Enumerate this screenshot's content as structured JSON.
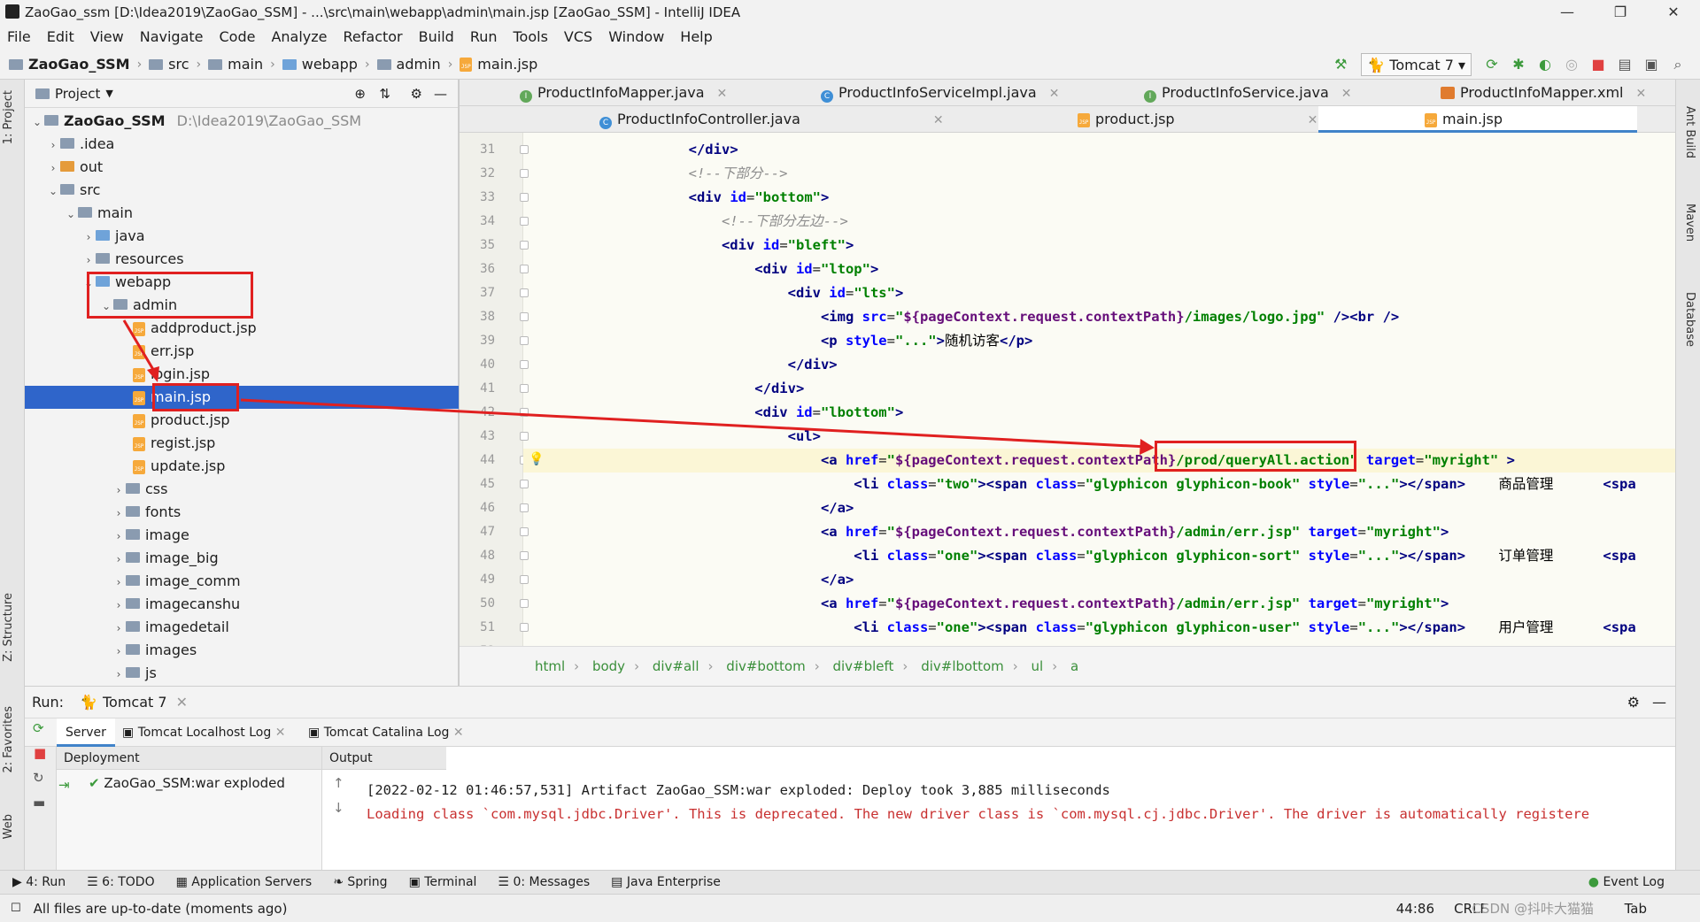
{
  "window": {
    "title": "ZaoGao_ssm [D:\\Idea2019\\ZaoGao_SSM] - ...\\src\\main\\webapp\\admin\\main.jsp [ZaoGao_SSM] - IntelliJ IDEA",
    "minimize": "—",
    "restore": "❐",
    "close": "✕"
  },
  "menu": [
    "File",
    "Edit",
    "View",
    "Navigate",
    "Code",
    "Analyze",
    "Refactor",
    "Build",
    "Run",
    "Tools",
    "VCS",
    "Window",
    "Help"
  ],
  "navbar": {
    "crumbs": [
      "ZaoGao_SSM",
      "src",
      "main",
      "webapp",
      "admin",
      "main.jsp"
    ],
    "run_config": "Tomcat 7"
  },
  "left_strip": {
    "project": "1: Project",
    "structure": "Z: Structure",
    "favorites": "2: Favorites",
    "web": "Web"
  },
  "right_strip": {
    "ant": "Ant Build",
    "maven": "Maven",
    "database": "Database"
  },
  "project": {
    "header": "Project",
    "root_name": "ZaoGao_SSM",
    "root_path": "D:\\Idea2019\\ZaoGao_SSM",
    "items": [
      ".idea",
      "out",
      "src",
      "main",
      "java",
      "resources",
      "webapp",
      "admin",
      "addproduct.jsp",
      "err.jsp",
      "login.jsp",
      "main.jsp",
      "product.jsp",
      "regist.jsp",
      "update.jsp",
      "css",
      "fonts",
      "image",
      "image_big",
      "image_comm",
      "imagecanshu",
      "imagedetail",
      "images",
      "js"
    ]
  },
  "editor": {
    "tabs_row1": [
      "ProductInfoMapper.java",
      "ProductInfoServiceImpl.java",
      "ProductInfoService.java",
      "ProductInfoMapper.xml"
    ],
    "tabs_row2": [
      "ProductInfoController.java",
      "product.jsp",
      "main.jsp"
    ],
    "line_numbers": [
      "31",
      "32",
      "33",
      "34",
      "35",
      "36",
      "37",
      "38",
      "39",
      "40",
      "41",
      "42",
      "43",
      "44",
      "45",
      "46",
      "47",
      "48",
      "49",
      "50",
      "51",
      "52"
    ],
    "lines": [
      "</div>",
      "<!--下部分-->",
      "<div id=\"bottom\">",
      "<!--下部分左边-->",
      "<div id=\"bleft\">",
      "<div id=\"ltop\">",
      "<div id=\"lts\">",
      "<img src=\"${pageContext.request.contextPath}/images/logo.jpg\" /><br />",
      "<p style=\"...\">随机访客</p>",
      "</div>",
      "</div>",
      "<div id=\"lbottom\">",
      "<ul>",
      "<a href=\"${pageContext.request.contextPath}/prod/queryAll.action\" target=\"myright\" >",
      "<li class=\"two\"><span class=\"glyphicon glyphicon-book\" style=\"...\"></span>    商品管理      <spa",
      "</a>",
      "<a href=\"${pageContext.request.contextPath}/admin/err.jsp\" target=\"myright\">",
      "<li class=\"one\"><span class=\"glyphicon glyphicon-sort\" style=\"...\"></span>    订单管理      <spa",
      "</a>",
      "<a href=\"${pageContext.request.contextPath}/admin/err.jsp\" target=\"myright\">",
      "<li class=\"one\"><span class=\"glyphicon glyphicon-user\" style=\"...\"></span>    用户管理      <spa",
      "</a>"
    ],
    "highlight_text": "/prod/queryAll.action",
    "breadcrumb": [
      "html",
      "body",
      "div#all",
      "div#bottom",
      "div#bleft",
      "div#lbottom",
      "ul",
      "a"
    ]
  },
  "run": {
    "label": "Run:",
    "config": "Tomcat 7",
    "tabs": [
      "Server",
      "Tomcat Localhost Log",
      "Tomcat Catalina Log"
    ],
    "deployment_header": "Deployment",
    "deployment_item": "ZaoGao_SSM:war exploded",
    "output_header": "Output",
    "output_lines": [
      "[2022-02-12 01:46:57,531] Artifact ZaoGao_SSM:war exploded: Deploy took 3,885 milliseconds",
      "Loading class `com.mysql.jdbc.Driver'. This is deprecated. The new driver class is `com.mysql.cj.jdbc.Driver'. The driver is automatically registere"
    ]
  },
  "bottom_tools": [
    "4: Run",
    "6: TODO",
    "Application Servers",
    "Spring",
    "Terminal",
    "0: Messages",
    "Java Enterprise"
  ],
  "event_log": "Event Log",
  "status": {
    "message": "All files are up-to-date (moments ago)",
    "position": "44:86",
    "line_sep": "CRLF",
    "indent": "Tab",
    "watermark": "CSDN @抖咔大猫猫"
  },
  "colors": {
    "accent": "#2f65ca",
    "annotation": "#e02020",
    "tag": "#000080",
    "string": "#008000"
  }
}
